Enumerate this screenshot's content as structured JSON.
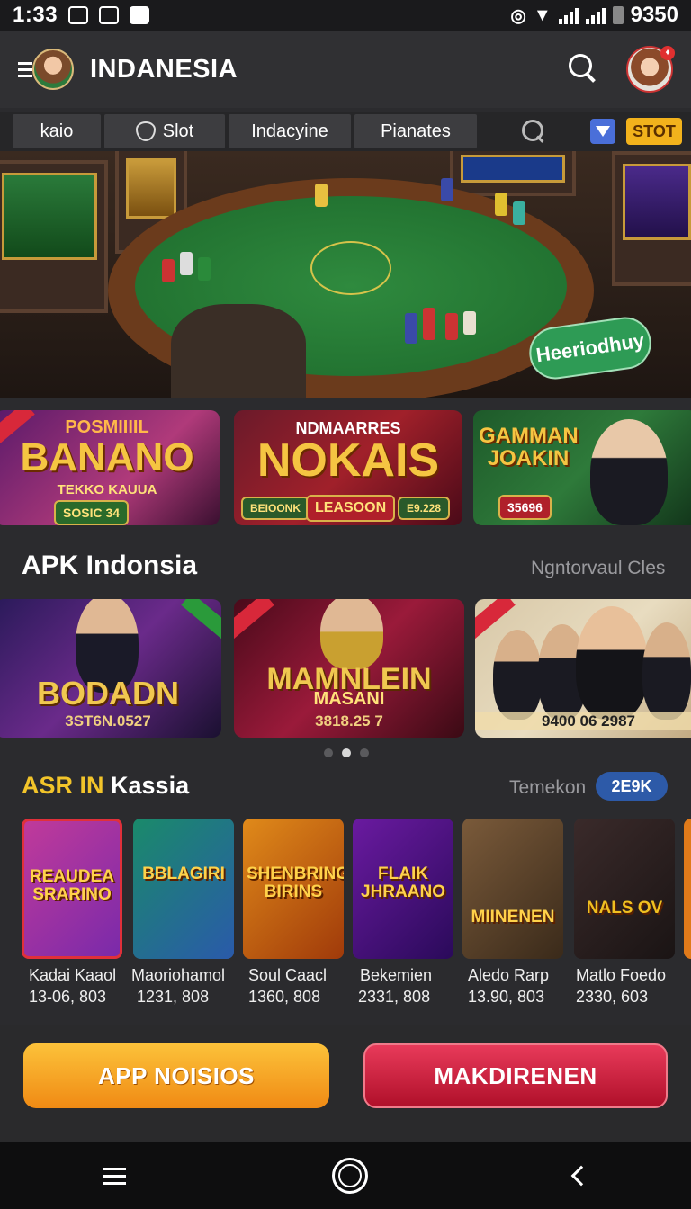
{
  "status_bar": {
    "time": "1:33",
    "battery": "9350"
  },
  "app_bar": {
    "title": "INDANESIA"
  },
  "tabs": [
    {
      "label": "kaio"
    },
    {
      "label": "Slot"
    },
    {
      "label": "Indacyine"
    },
    {
      "label": "Pianates"
    }
  ],
  "tab_actions": {
    "slot_button": "STOT"
  },
  "hero": {
    "badge": "Heeriodhuy"
  },
  "promos": [
    {
      "title": "BANANO",
      "kicker": "POSMIIIIL",
      "sub": "TEKKO KAUUA",
      "pill": "SOSIC 34"
    },
    {
      "title": "NOKAIS",
      "kicker": "NDMAARRES",
      "btn1": "BEIOONK",
      "btn2": "LEASOON",
      "btn3": "E9.228"
    },
    {
      "title": "GAMMAN JOAKIN",
      "pill": "35696"
    }
  ],
  "apk_section": {
    "title": "APK Indonsia",
    "link": "Ngntorvaul Cles",
    "cards": [
      {
        "label": "BODADN",
        "value": "3ST6N.0527"
      },
      {
        "label": "MAMNLEIN",
        "sub": "MASANI",
        "value": "3818.25 7"
      },
      {
        "label": "",
        "value": "9400 06 2987"
      }
    ]
  },
  "kassia_section": {
    "title_highlight": "ASR IN",
    "title_rest": "Kassia",
    "link": "Temekon",
    "badge": "2E9K",
    "games": [
      {
        "art": "REAUDEA SRARINO",
        "name": "Kadai Kaaol",
        "value": "13-06, 803"
      },
      {
        "art": "BBLAGIRI",
        "name": "Maoriohamol",
        "value": "1231, 808"
      },
      {
        "art": "SHENBRING BIRINS",
        "name": "Soul Caacl",
        "value": "1360, 808"
      },
      {
        "art": "FLAIK JHRAANO",
        "name": "Bekemien",
        "value": "2331, 808"
      },
      {
        "art": "MIINENEN",
        "name": "Aledo Rarp",
        "value": "13.90, 803"
      },
      {
        "art": "NALS OV",
        "name": "Matlo Foedo",
        "value": "2330, 603"
      }
    ]
  },
  "actions": {
    "primary": "APP NOISIOS",
    "secondary": "MAKDIRENEN"
  }
}
